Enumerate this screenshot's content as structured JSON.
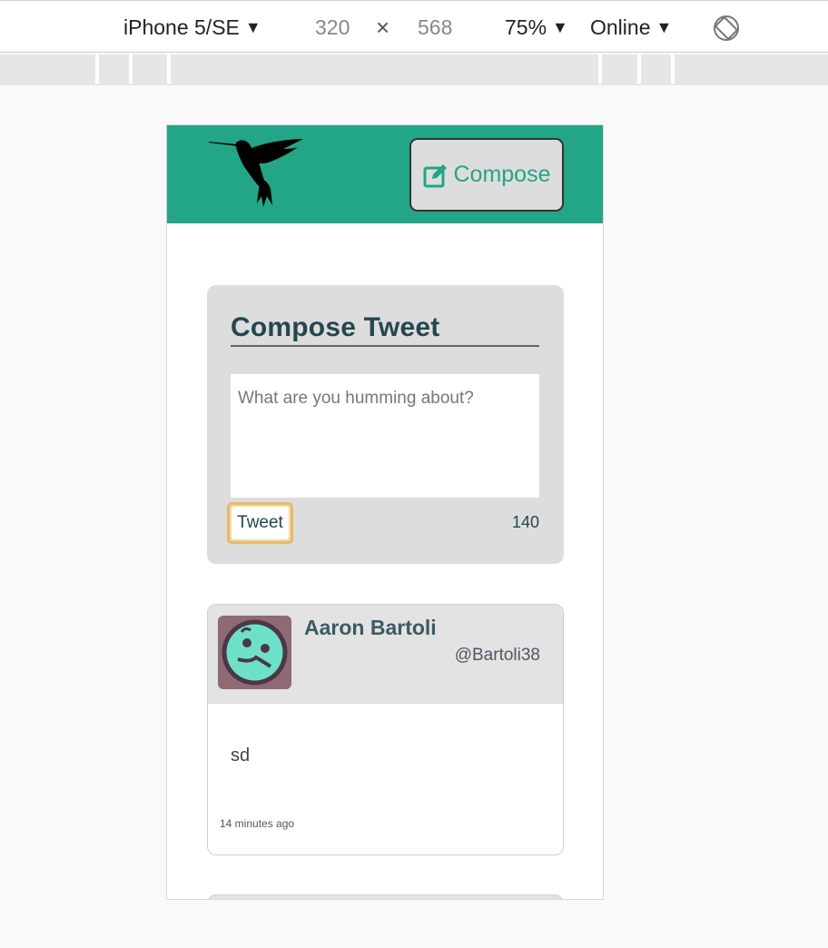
{
  "device_toolbar": {
    "device": "iPhone 5/SE",
    "width": "320",
    "times": "×",
    "height": "568",
    "zoom": "75%",
    "network": "Online",
    "caret": "▼",
    "rotate_icon": "rotate-icon"
  },
  "app": {
    "brand_color": "#23a587",
    "logo_icon": "hummingbird-icon",
    "compose_button": {
      "icon": "edit-icon",
      "label": "Compose"
    },
    "compose_box": {
      "title": "Compose Tweet",
      "placeholder": "What are you humming about?",
      "submit_label": "Tweet",
      "counter": "140"
    },
    "tweets": [
      {
        "name": "Aaron Bartoli",
        "handle": "@Bartoli38",
        "content": "sd",
        "time": "14 minutes ago",
        "avatar_icon": "avatar-icon"
      }
    ]
  }
}
